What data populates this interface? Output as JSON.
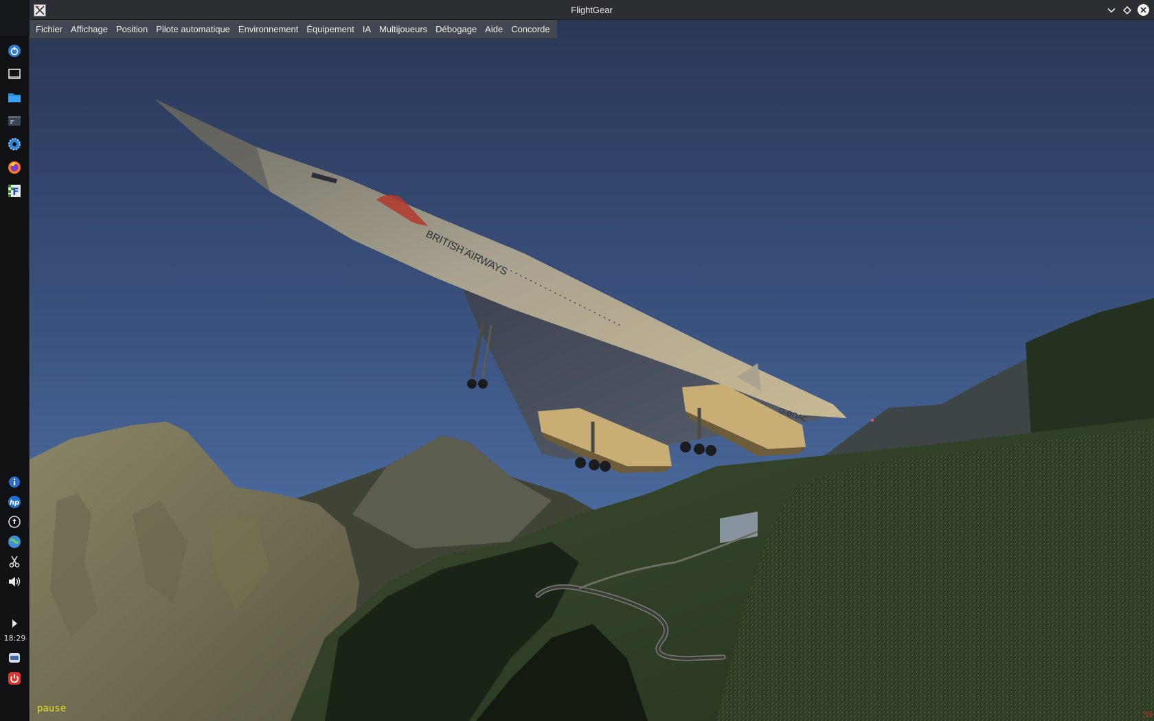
{
  "window": {
    "title": "FlightGear"
  },
  "menubar": {
    "items": [
      {
        "label": "Fichier"
      },
      {
        "label": "Affichage"
      },
      {
        "label": "Position"
      },
      {
        "label": "Pilote automatique"
      },
      {
        "label": "Environnement"
      },
      {
        "label": "Équipement"
      },
      {
        "label": "IA"
      },
      {
        "label": "Multijoueurs"
      },
      {
        "label": "Débogage"
      },
      {
        "label": "Aide"
      },
      {
        "label": "Concorde"
      }
    ]
  },
  "dock": {
    "top_icons": [
      "launcher-icon",
      "desktop-icon",
      "file-manager-icon",
      "terminal-icon",
      "settings-icon",
      "firefox-icon",
      "flightgear-icon"
    ],
    "bottom_icons": [
      "info-icon",
      "hp-icon",
      "updates-icon",
      "network-icon",
      "scissors-icon",
      "volume-icon",
      "expand-arrow-icon"
    ],
    "clock": "18:29",
    "tray_icons": [
      "disk-icon",
      "power-icon"
    ]
  },
  "scene": {
    "livery_text": "BRITISH AIRWAYS",
    "registration": "G-BOAC",
    "status_text": "pause",
    "fps_text": "59"
  },
  "colors": {
    "sky_top": "#2c3a5c",
    "sky_bottom": "#4a689a",
    "titlebar": "#2b2e33",
    "menubar": "#464a50",
    "pause_text": "#e4e02a"
  }
}
